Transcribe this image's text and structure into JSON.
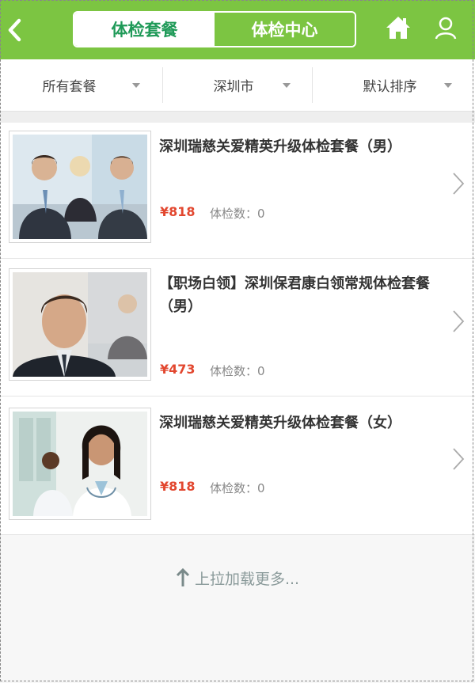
{
  "header": {
    "tabs": [
      {
        "label": "体检套餐",
        "active": true
      },
      {
        "label": "体检中心",
        "active": false
      }
    ],
    "icons": {
      "back": "chevron-left-icon",
      "home": "home-icon",
      "user": "user-icon"
    },
    "accent_color": "#7cc542"
  },
  "filters": [
    {
      "label": "所有套餐"
    },
    {
      "label": "深圳市"
    },
    {
      "label": "默认排序"
    }
  ],
  "packages": [
    {
      "title": "深圳瑞慈关爱精英升级体检套餐（男）",
      "price": "¥818",
      "count": "体检数：0"
    },
    {
      "title": "【职场白领】深圳保君康白领常规体检套餐（男）",
      "price": "¥473",
      "count": "体检数：0"
    },
    {
      "title": "深圳瑞慈关爱精英升级体检套餐（女）",
      "price": "¥818",
      "count": "体检数：0"
    }
  ],
  "load_more": {
    "label": "上拉加载更多..."
  },
  "price_color": "#e2472f"
}
